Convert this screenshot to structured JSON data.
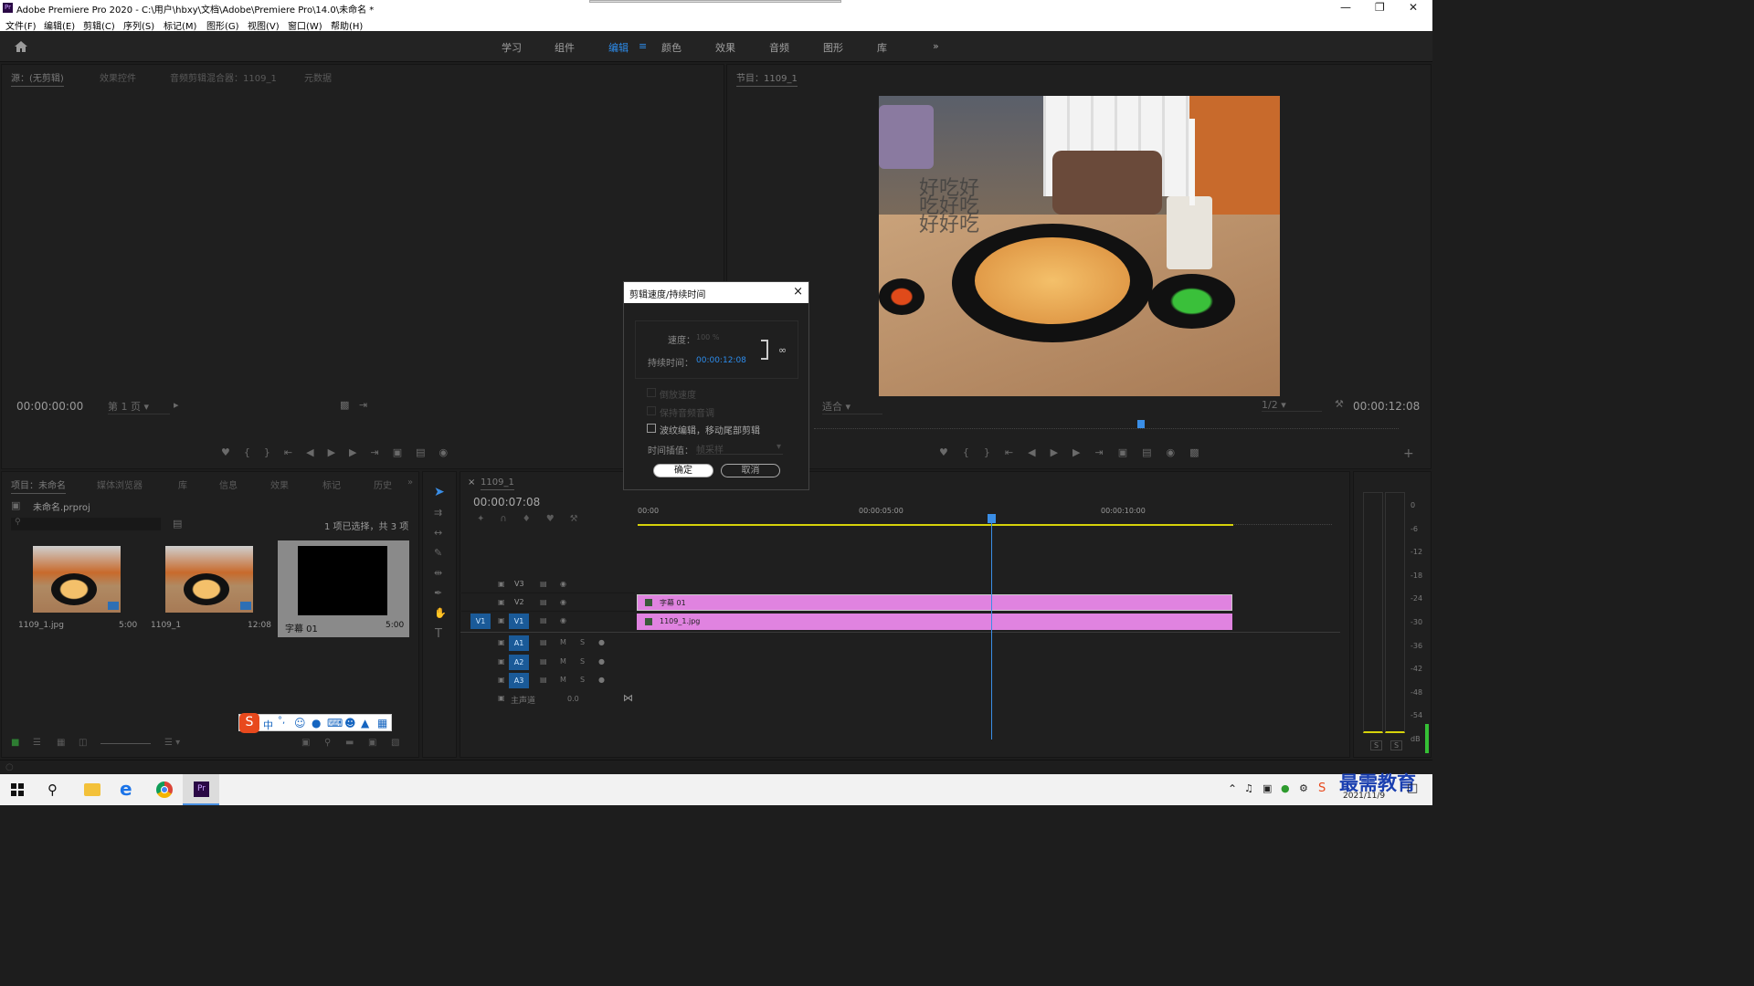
{
  "app": {
    "title": "Adobe Premiere Pro 2020 - C:\\用户\\hbxy\\文档\\Adobe\\Premiere Pro\\14.0\\未命名 *",
    "logo": "Pr"
  },
  "menu": [
    "文件(F)",
    "编辑(E)",
    "剪辑(C)",
    "序列(S)",
    "标记(M)",
    "图形(G)",
    "视图(V)",
    "窗口(W)",
    "帮助(H)"
  ],
  "workspaces": [
    "学习",
    "组件",
    "编辑",
    "颜色",
    "效果",
    "音频",
    "图形",
    "库"
  ],
  "source": {
    "tabs": [
      "源：(无剪辑)",
      "效果控件",
      "音频剪辑混合器：1109_1",
      "元数据"
    ],
    "timecode": "00:00:00:00",
    "page": "第 1 页"
  },
  "program": {
    "tab": "节目：1109_1",
    "timecode": "00:00:12:08",
    "fit": "适合",
    "ratio": "1/2",
    "overlay_text": "好吃好吃好吃好好吃"
  },
  "project": {
    "tabs": [
      "项目：未命名",
      "媒体浏览器",
      "库",
      "信息",
      "效果",
      "标记",
      "历史"
    ],
    "file": "未命名.prproj",
    "selection": "1 项已选择，共 3 项",
    "items": [
      {
        "name": "1109_1.jpg",
        "dur": "5:00"
      },
      {
        "name": "1109_1",
        "dur": "12:08"
      },
      {
        "name": "字幕 01",
        "dur": "5:00"
      }
    ]
  },
  "timeline": {
    "tab": "1109_1",
    "timecode": "00:00:07:08",
    "ruler": [
      "00:00",
      "00:00:05:00",
      "00:00:10:00"
    ],
    "tracks": [
      "V3",
      "V2",
      "V1",
      "A1",
      "A2",
      "A3"
    ],
    "master": "主声道",
    "master_val": "0.0",
    "v1_patch": "V1",
    "clips": [
      {
        "name": "字幕 01"
      },
      {
        "name": "1109_1.jpg"
      }
    ]
  },
  "dialog": {
    "title": "剪辑速度/持续时间",
    "speed_label": "速度：",
    "speed": "100 %",
    "duration_label": "持续时间：",
    "duration": "00:00:12:08",
    "opt_reverse": "倒放速度",
    "opt_pitch": "保持音频音调",
    "opt_ripple": "波纹编辑，移动尾部剪辑",
    "interp_label": "时间插值：",
    "interp": "帧采样",
    "ok": "确定",
    "cancel": "取消"
  },
  "meter": {
    "ticks": [
      "0",
      "-6",
      "-12",
      "-18",
      "-24",
      "-30",
      "-36",
      "-42",
      "-48",
      "-54",
      "dB"
    ],
    "solo": [
      "S",
      "S"
    ]
  },
  "ime": {
    "labels": [
      "中",
      "°,"
    ]
  },
  "taskbar": {
    "date": "2021/11/9",
    "watermark": "最需教育"
  },
  "colors": {
    "accent": "#2d8ceb",
    "clip": "#e083e0",
    "playhead": "#3a8ee6"
  }
}
